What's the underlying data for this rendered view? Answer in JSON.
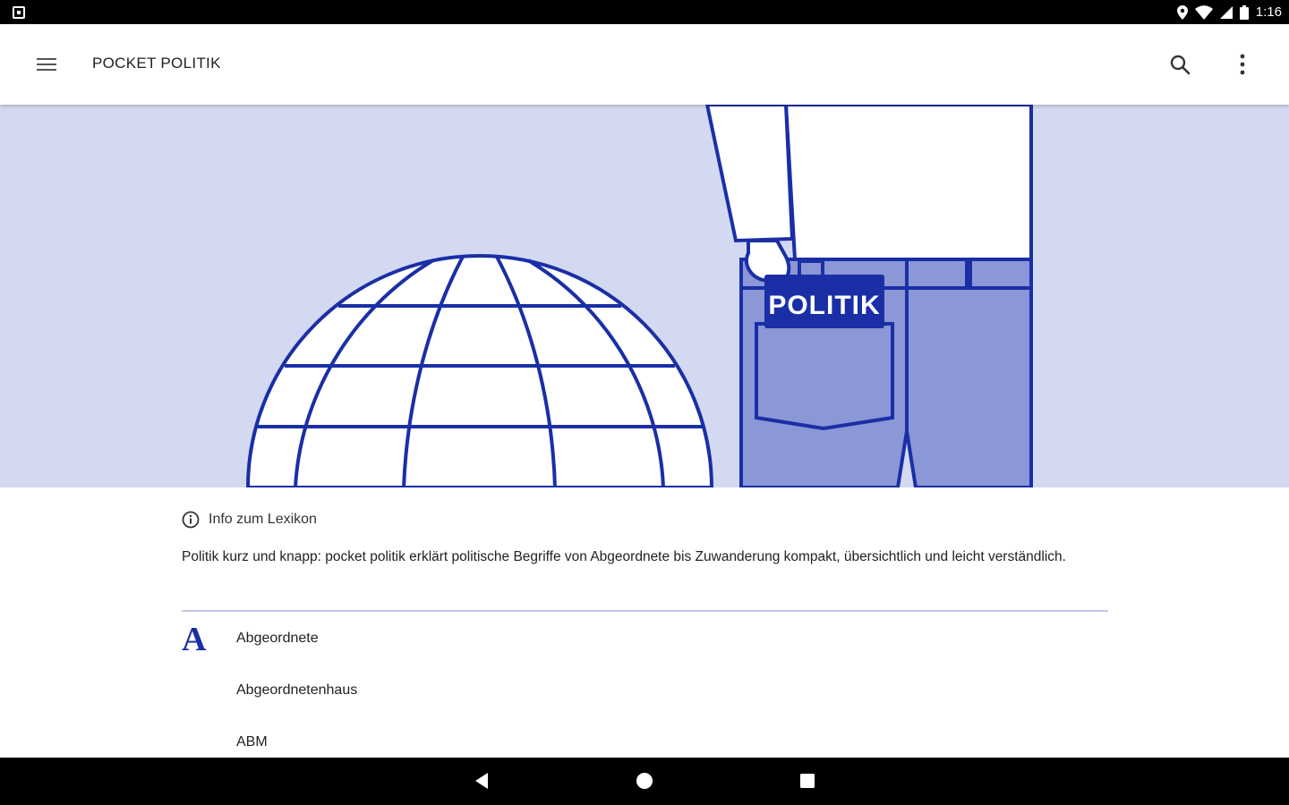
{
  "status_bar": {
    "time": "1:16",
    "icons": [
      "location-icon",
      "wifi-icon",
      "signal-icon",
      "battery-icon"
    ]
  },
  "app_bar": {
    "title": "POCKET POLITIK",
    "menu_icon": "hamburger-menu-icon",
    "search_icon": "search-icon",
    "overflow_icon": "more-vert-icon"
  },
  "hero": {
    "pocket_label": "POLITIK",
    "colors": {
      "background": "#d3d9f1",
      "stroke": "#1a2fa6",
      "jeans": "#8b97d6",
      "tag": "#1a2fa6"
    }
  },
  "info": {
    "icon": "info-icon",
    "label": "Info zum Lexikon",
    "description": "Politik kurz und knapp: pocket politik erklärt politische Begriffe von Abgeordnete bis Zuwanderung kompakt, übersichtlich und leicht verständlich."
  },
  "lexicon": {
    "letter": "A",
    "entries": [
      "Abgeordnete",
      "Abgeordnetenhaus",
      "ABM"
    ]
  },
  "nav_bar": {
    "buttons": [
      "back-icon",
      "home-icon",
      "recents-icon"
    ]
  },
  "colors": {
    "accent": "#1a2fa6",
    "divider": "#c3c9e8"
  }
}
